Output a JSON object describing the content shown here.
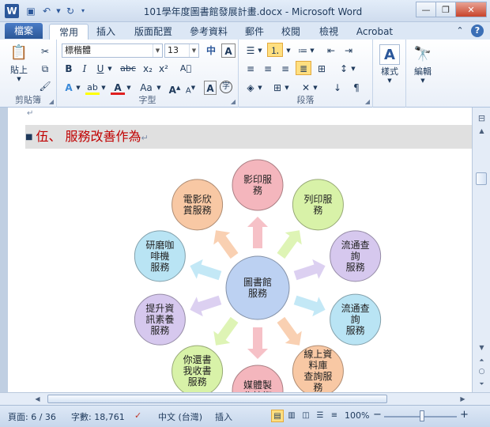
{
  "window": {
    "title": "101學年度圖書館發展計畫.docx - Microsoft Word",
    "app_icon": "W"
  },
  "tabs": {
    "file": "檔案",
    "items": [
      "常用",
      "插入",
      "版面配置",
      "參考資料",
      "郵件",
      "校閱",
      "檢視",
      "Acrobat"
    ],
    "active_index": 0
  },
  "ribbon": {
    "clipboard": {
      "paste_label": "貼上",
      "group_label": "剪貼簿"
    },
    "font": {
      "name": "標楷體",
      "size": "13",
      "group_label": "字型"
    },
    "paragraph": {
      "group_label": "段落"
    },
    "styles": {
      "label": "樣式"
    },
    "editing": {
      "label": "編輯"
    }
  },
  "document": {
    "top_mark": "↵",
    "heading": "伍、 服務改善作為",
    "heading_mark": "↵",
    "heading_color": "#c00000"
  },
  "diagram": {
    "center": {
      "label": [
        "圖書館",
        "服務"
      ],
      "color": "#bcd1f2"
    },
    "nodes": [
      {
        "label": [
          "影印服",
          "務"
        ],
        "color": "#f4b6bd"
      },
      {
        "label": [
          "列印服",
          "務"
        ],
        "color": "#d8f2a8"
      },
      {
        "label": [
          "流通查",
          "詢",
          "服務"
        ],
        "color": "#d6c8ee"
      },
      {
        "label": [
          "流通查",
          "詢",
          "服務"
        ],
        "color": "#b9e4f4"
      },
      {
        "label": [
          "線上資",
          "料庫",
          "查詢服",
          "務"
        ],
        "color": "#f8c8a4"
      },
      {
        "label": [
          "媒體製",
          "作技術"
        ],
        "color": "#f4b6bd"
      },
      {
        "label": [
          "你還書",
          "我收書",
          "服務"
        ],
        "color": "#d8f2a8"
      },
      {
        "label": [
          "提升資",
          "訊素養",
          "服務"
        ],
        "color": "#d6c8ee"
      },
      {
        "label": [
          "研磨咖",
          "啡機",
          "服務"
        ],
        "color": "#b9e4f4"
      },
      {
        "label": [
          "電影欣",
          "賞服務"
        ],
        "color": "#f8c8a4"
      }
    ]
  },
  "status": {
    "page": "頁面: 6 / 36",
    "words": "字數: 18,761",
    "language": "中文 (台灣)",
    "mode": "插入",
    "zoom": "100%",
    "zoom_minus": "−",
    "zoom_plus": "+"
  }
}
